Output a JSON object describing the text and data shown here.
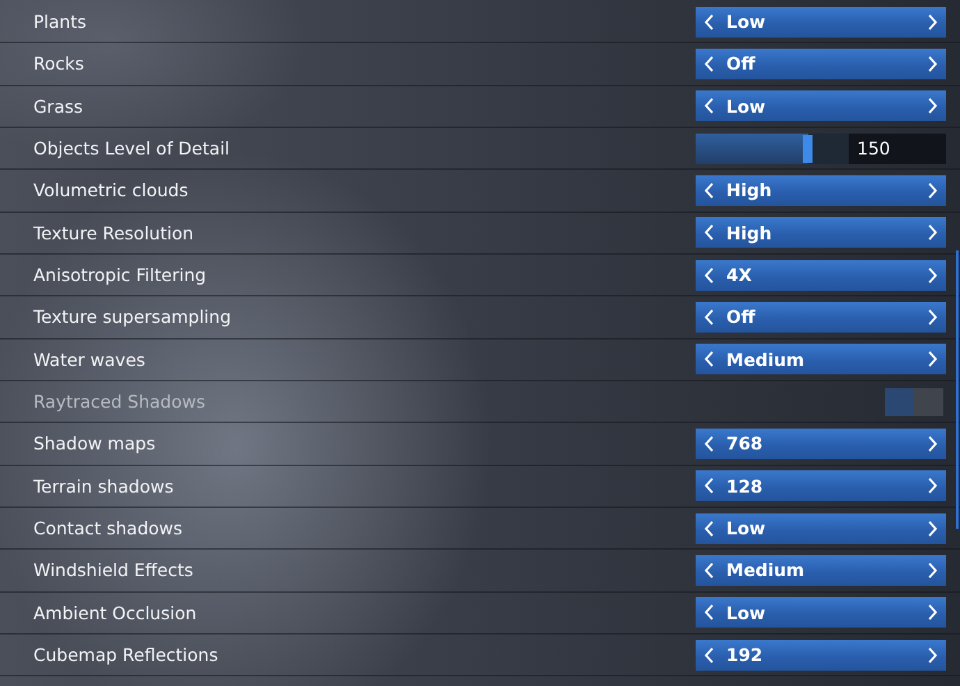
{
  "settings": [
    {
      "label": "Plants",
      "kind": "selector",
      "value": "Low",
      "disabled": false
    },
    {
      "label": "Rocks",
      "kind": "selector",
      "value": "Off",
      "disabled": false
    },
    {
      "label": "Grass",
      "kind": "selector",
      "value": "Low",
      "disabled": false
    },
    {
      "label": "Objects Level of Detail",
      "kind": "slider",
      "value": "150",
      "level": 0.74,
      "disabled": false
    },
    {
      "label": "Volumetric clouds",
      "kind": "selector",
      "value": "High",
      "disabled": false
    },
    {
      "label": "Texture Resolution",
      "kind": "selector",
      "value": "High",
      "disabled": false
    },
    {
      "label": "Anisotropic Filtering",
      "kind": "selector",
      "value": "4X",
      "disabled": false
    },
    {
      "label": "Texture supersampling",
      "kind": "selector",
      "value": "Off",
      "disabled": false
    },
    {
      "label": "Water waves",
      "kind": "selector",
      "value": "Medium",
      "disabled": false
    },
    {
      "label": "Raytraced Shadows",
      "kind": "toggle",
      "on": false,
      "disabled": true
    },
    {
      "label": "Shadow maps",
      "kind": "selector",
      "value": "768",
      "disabled": false
    },
    {
      "label": "Terrain shadows",
      "kind": "selector",
      "value": "128",
      "disabled": false
    },
    {
      "label": "Contact shadows",
      "kind": "selector",
      "value": "Low",
      "disabled": false
    },
    {
      "label": "Windshield Effects",
      "kind": "selector",
      "value": "Medium",
      "disabled": false
    },
    {
      "label": "Ambient Occlusion",
      "kind": "selector",
      "value": "Low",
      "disabled": false
    },
    {
      "label": "Cubemap Reflections",
      "kind": "selector",
      "value": "192",
      "disabled": false
    }
  ]
}
